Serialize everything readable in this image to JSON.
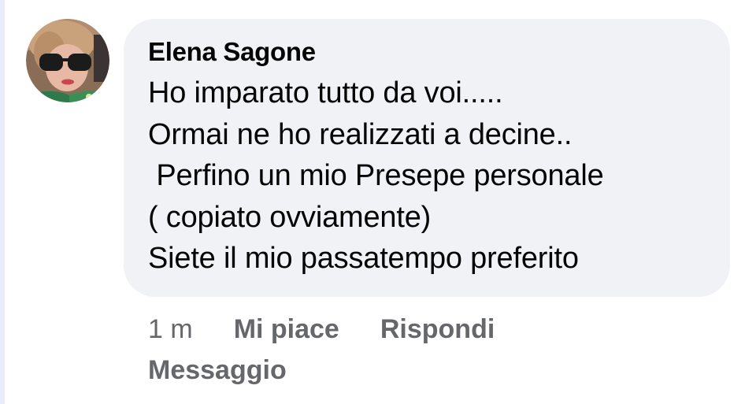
{
  "comment": {
    "author": "Elena Sagone",
    "lines": [
      "Ho imparato tutto da voi.....",
      "Ormai ne ho realizzati a decine..",
      " Perfino un mio Presepe personale",
      "( copiato ovviamente)",
      "Siete il mio passatempo preferito"
    ]
  },
  "actions": {
    "time": "1 m",
    "like_label": "Mi piace",
    "reply_label": "Rispondi",
    "message_label": "Messaggio"
  },
  "colors": {
    "bubble_bg": "#f0f2f5",
    "text": "#050505",
    "action_text": "#65676b"
  }
}
